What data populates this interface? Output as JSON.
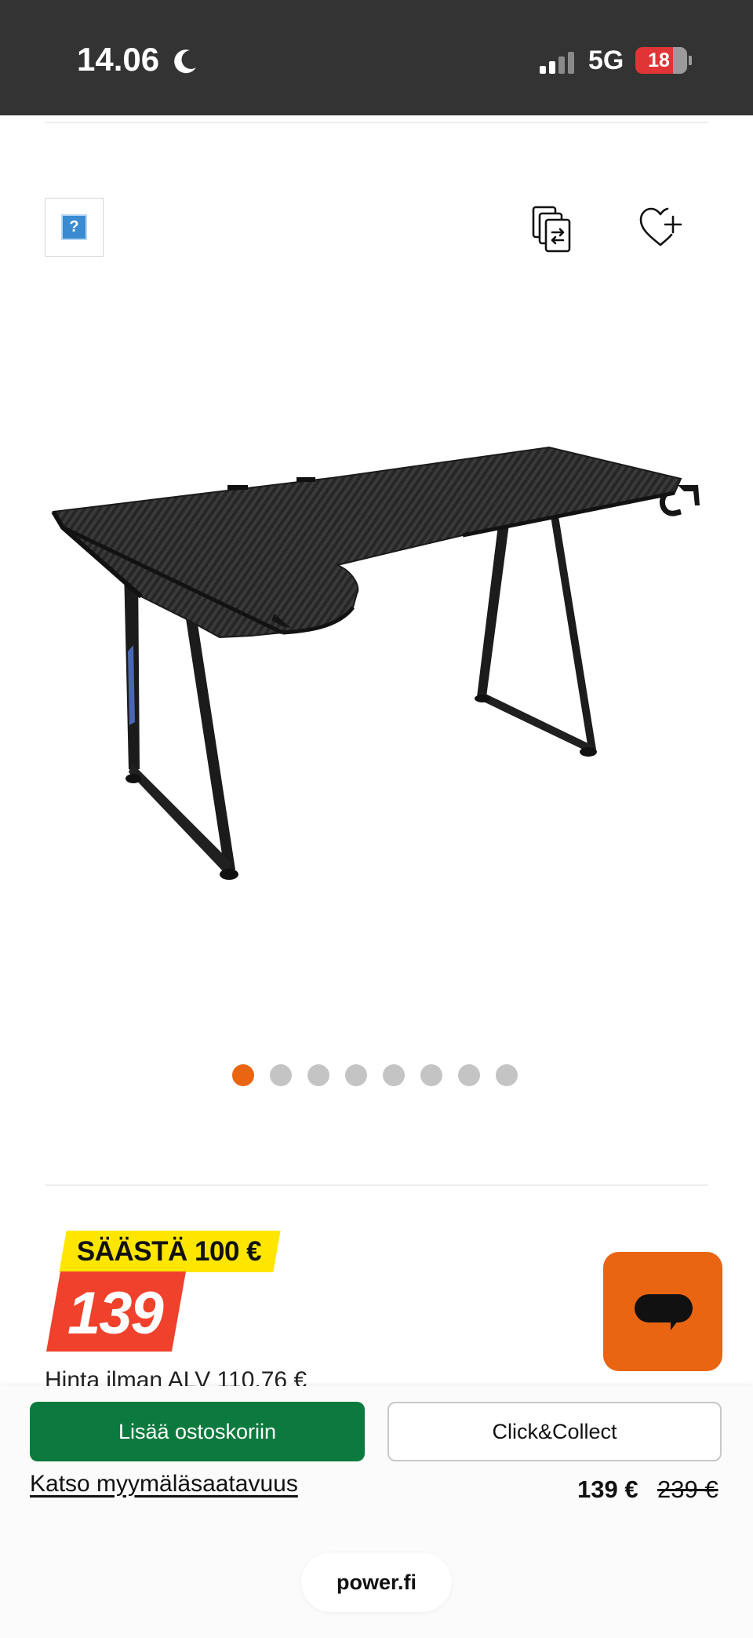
{
  "status_bar": {
    "time": "14.06",
    "network": "5G",
    "battery": "18",
    "moon_icon": "moon-icon",
    "signal_icon": "signal-bars-icon"
  },
  "toolbar": {
    "image_placeholder_icon": "question-image-icon",
    "compare_icon": "compare-icon",
    "wishlist_icon": "heart-plus-icon"
  },
  "gallery": {
    "image_count": 8,
    "active_index": 0,
    "active_color": "#ea6512",
    "inactive_color": "#c4c4c4"
  },
  "price": {
    "save_label": "SÄÄSTÄ 100 €",
    "big_price": "139",
    "vat_text": "Hinta ilman ALV 110,76 €"
  },
  "chat": {
    "icon": "chat-bubble-icon",
    "color": "#ea6512"
  },
  "sticky": {
    "add_to_cart": "Lisää ostoskoriin",
    "click_collect": "Click&Collect",
    "store_link": "Katso myymäläsaatavuus",
    "current_price": "139 €",
    "old_price": "239 €"
  },
  "browser": {
    "url": "power.fi"
  },
  "colors": {
    "status_bar": "#333333",
    "save_badge": "#ffe600",
    "price_badge": "#f0412c",
    "add_to_cart": "#0c7a3e"
  }
}
